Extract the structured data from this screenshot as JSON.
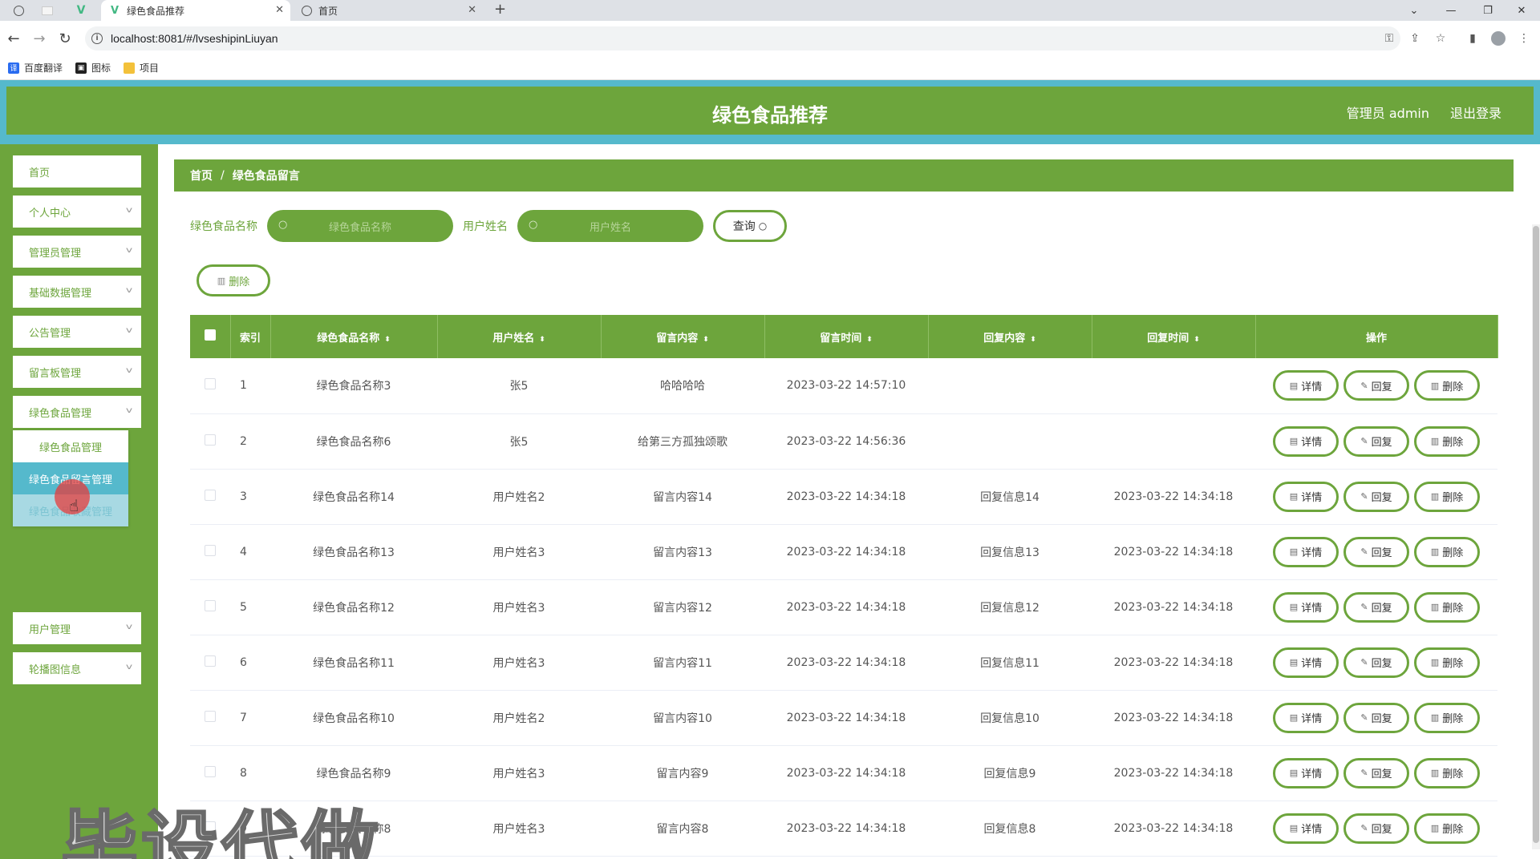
{
  "browser": {
    "tabs": [
      {
        "title": "绿色食品推荐",
        "active": true
      },
      {
        "title": "首页",
        "active": false
      }
    ],
    "new_tab": "+",
    "url": "localhost:8081/#/lvseshipinLiuyan",
    "bookmarks": [
      {
        "label": "百度翻译",
        "icon": "translate-icon",
        "color": "#2a6cf0"
      },
      {
        "label": "图标",
        "icon": "image-icon",
        "color": "#222222"
      },
      {
        "label": "项目",
        "icon": "folder-icon",
        "color": "#f3c13a"
      }
    ]
  },
  "header": {
    "title": "绿色食品推荐",
    "admin": "管理员 admin",
    "logout": "退出登录",
    "bar_color": "#6da53c",
    "accent": "#55b9cc"
  },
  "sidebar": {
    "items": [
      {
        "label": "首页",
        "has_arrow": false
      },
      {
        "label": "个人中心",
        "has_arrow": true
      },
      {
        "label": "管理员管理",
        "has_arrow": true
      },
      {
        "label": "基础数据管理",
        "has_arrow": true
      },
      {
        "label": "公告管理",
        "has_arrow": true
      },
      {
        "label": "留言板管理",
        "has_arrow": true
      },
      {
        "label": "绿色食品管理",
        "has_arrow": true
      },
      {
        "label": "用户管理",
        "has_arrow": true
      },
      {
        "label": "轮播图信息",
        "has_arrow": true
      }
    ],
    "submenu": [
      {
        "label": "绿色食品管理",
        "state": "normal"
      },
      {
        "label": "绿色食品留言管理",
        "state": "active"
      },
      {
        "label": "绿色食品收藏管理",
        "state": "hover"
      }
    ]
  },
  "breadcrumb": {
    "home": "首页",
    "separator": "/",
    "current": "绿色食品留言"
  },
  "search": {
    "name_label": "绿色食品名称",
    "name_placeholder": "绿色食品名称",
    "user_label": "用户姓名",
    "user_placeholder": "用户姓名",
    "query_label": "查询",
    "delete_label": "删除"
  },
  "table": {
    "headers": [
      "",
      "索引",
      "绿色食品名称",
      "用户姓名",
      "留言内容",
      "留言时间",
      "回复内容",
      "回复时间",
      "操作"
    ],
    "actions": {
      "detail": "详情",
      "reply": "回复",
      "delete": "删除"
    },
    "rows": [
      {
        "idx": "1",
        "name": "绿色食品名称3",
        "user": "张5",
        "content": "哈哈哈哈",
        "time": "2023-03-22 14:57:10",
        "reply": "",
        "reply_time": ""
      },
      {
        "idx": "2",
        "name": "绿色食品名称6",
        "user": "张5",
        "content": "给第三方孤独颂歌",
        "time": "2023-03-22 14:56:36",
        "reply": "",
        "reply_time": ""
      },
      {
        "idx": "3",
        "name": "绿色食品名称14",
        "user": "用户姓名2",
        "content": "留言内容14",
        "time": "2023-03-22 14:34:18",
        "reply": "回复信息14",
        "reply_time": "2023-03-22 14:34:18"
      },
      {
        "idx": "4",
        "name": "绿色食品名称13",
        "user": "用户姓名3",
        "content": "留言内容13",
        "time": "2023-03-22 14:34:18",
        "reply": "回复信息13",
        "reply_time": "2023-03-22 14:34:18"
      },
      {
        "idx": "5",
        "name": "绿色食品名称12",
        "user": "用户姓名3",
        "content": "留言内容12",
        "time": "2023-03-22 14:34:18",
        "reply": "回复信息12",
        "reply_time": "2023-03-22 14:34:18"
      },
      {
        "idx": "6",
        "name": "绿色食品名称11",
        "user": "用户姓名3",
        "content": "留言内容11",
        "time": "2023-03-22 14:34:18",
        "reply": "回复信息11",
        "reply_time": "2023-03-22 14:34:18"
      },
      {
        "idx": "7",
        "name": "绿色食品名称10",
        "user": "用户姓名2",
        "content": "留言内容10",
        "time": "2023-03-22 14:34:18",
        "reply": "回复信息10",
        "reply_time": "2023-03-22 14:34:18"
      },
      {
        "idx": "8",
        "name": "绿色食品名称9",
        "user": "用户姓名3",
        "content": "留言内容9",
        "time": "2023-03-22 14:34:18",
        "reply": "回复信息9",
        "reply_time": "2023-03-22 14:34:18"
      },
      {
        "idx": "9",
        "name": "绿色食品名称8",
        "user": "用户姓名3",
        "content": "留言内容8",
        "time": "2023-03-22 14:34:18",
        "reply": "回复信息8",
        "reply_time": "2023-03-22 14:34:18"
      }
    ]
  },
  "watermark": "毕设代做"
}
